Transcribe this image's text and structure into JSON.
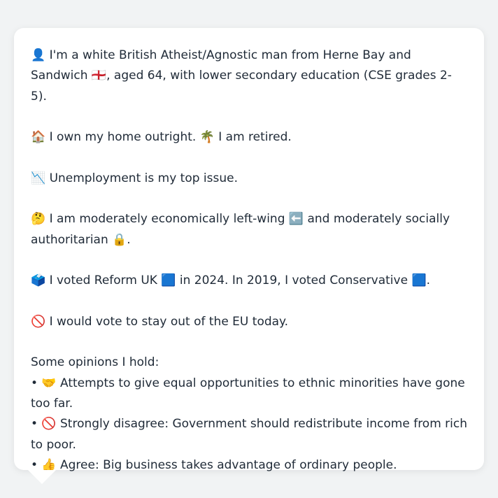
{
  "profile": {
    "identity": "👤 I'm a white British Atheist/Agnostic man from Herne Bay and Sandwich 🏴󠁧󠁢󠁥󠁮󠁧󠁿, aged 64, with lower secondary education (CSE grades 2-5).",
    "housing": "🏠 I own my home outright. 🌴 I am retired.",
    "top_issue": "📉 Unemployment is my top issue.",
    "ideology": "🤔 I am moderately economically left-wing ⬅️ and moderately socially authoritarian 🔒.",
    "voting": "🗳️ I voted Reform UK 🟦 in 2024. In 2019, I voted Conservative 🟦.",
    "eu": "🚫 I would vote to stay out of the EU today.",
    "opinions_heading": "Some opinions I hold:",
    "opinions": [
      "• 🤝 Attempts to give equal opportunities to ethnic minorities have gone too far.",
      "• 🚫 Strongly disagree: Government should redistribute income from rich to poor.",
      "• 👍 Agree: Big business takes advantage of ordinary people."
    ]
  }
}
